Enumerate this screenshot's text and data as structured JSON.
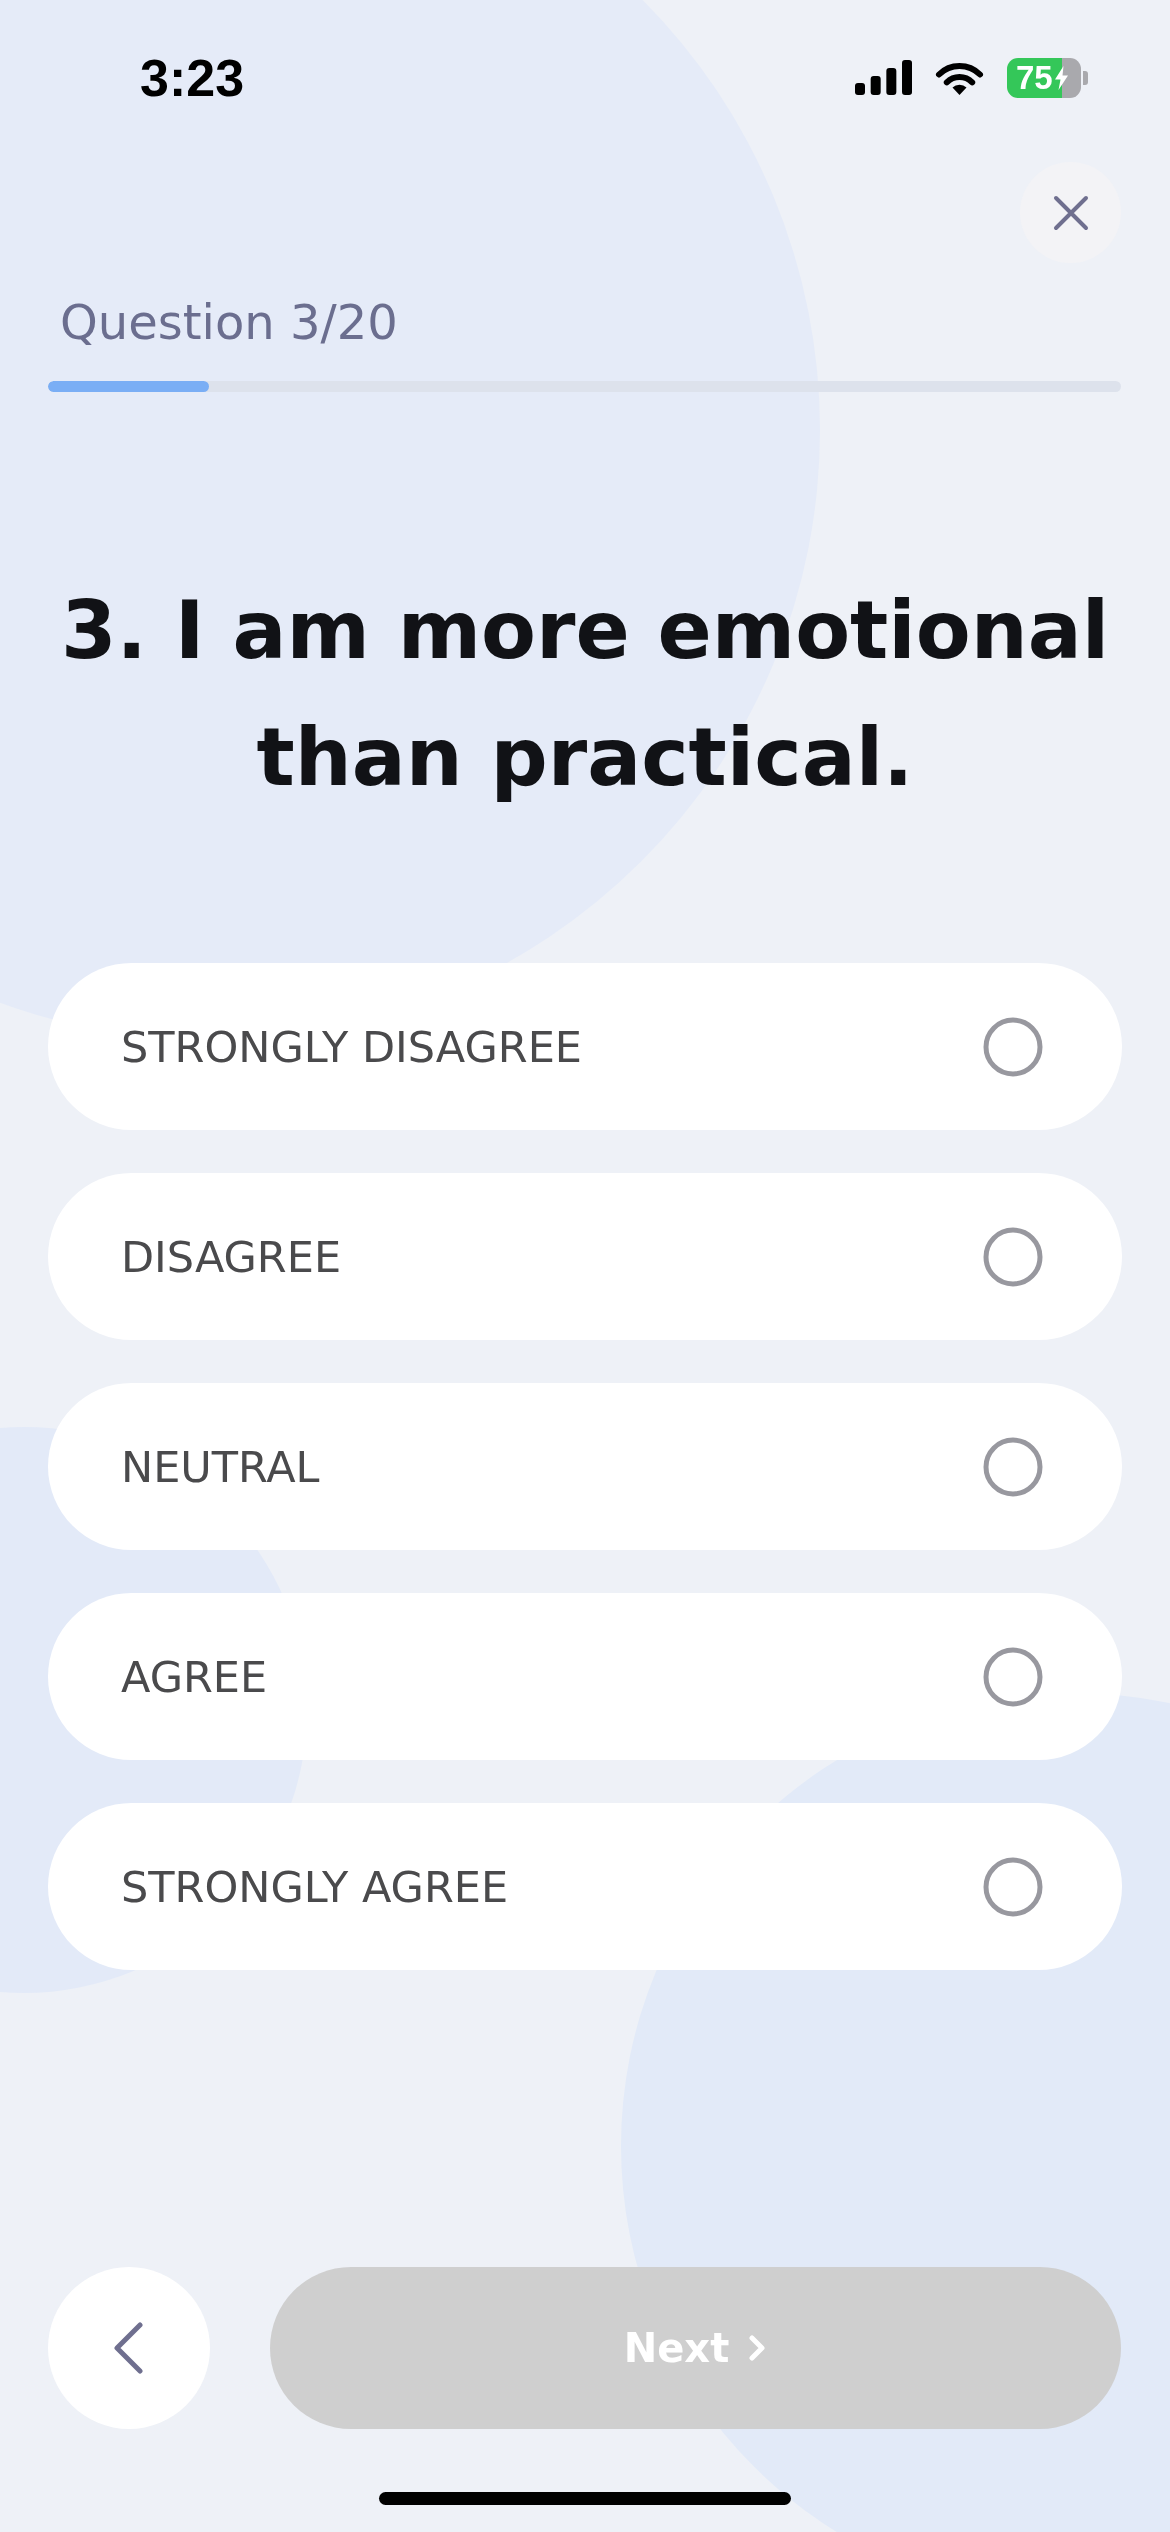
{
  "status_bar": {
    "time": "3:23",
    "battery": {
      "percent": "75",
      "charging": true
    }
  },
  "header": {
    "progress_label": "Question 3/20",
    "progress": {
      "level": 0.15
    }
  },
  "question": {
    "text": "3. I am more emotional than practical."
  },
  "options": [
    {
      "label": "STRONGLY DISAGREE",
      "selected": false
    },
    {
      "label": "DISAGREE",
      "selected": false
    },
    {
      "label": "NEUTRAL",
      "selected": false
    },
    {
      "label": "AGREE",
      "selected": false
    },
    {
      "label": "STRONGLY AGREE",
      "selected": false
    }
  ],
  "footer": {
    "next": {
      "label": "Next",
      "disabled": true
    }
  }
}
